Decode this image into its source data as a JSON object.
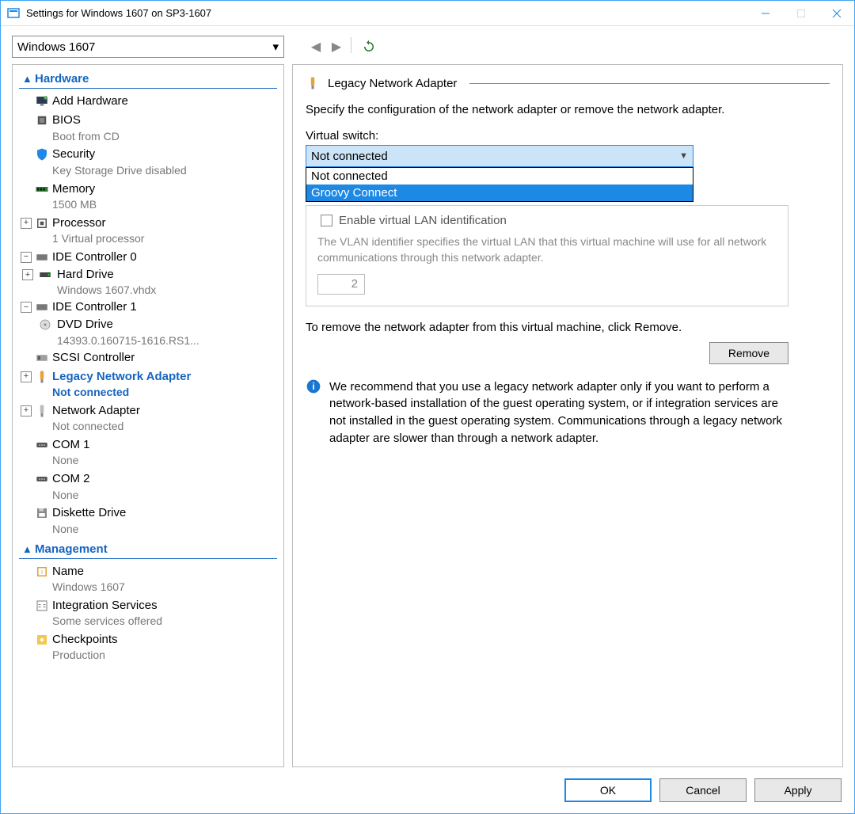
{
  "titlebar": {
    "title": "Settings for Windows 1607 on SP3-1607"
  },
  "vm_selector": {
    "value": "Windows 1607"
  },
  "sidebar": {
    "sections": {
      "hardware": "Hardware",
      "management": "Management"
    },
    "items": [
      {
        "label": "Add Hardware",
        "sub": ""
      },
      {
        "label": "BIOS",
        "sub": "Boot from CD"
      },
      {
        "label": "Security",
        "sub": "Key Storage Drive disabled"
      },
      {
        "label": "Memory",
        "sub": "1500 MB"
      },
      {
        "label": "Processor",
        "sub": "1 Virtual processor"
      },
      {
        "label": "IDE Controller 0",
        "sub": ""
      },
      {
        "label": "Hard Drive",
        "sub": "Windows 1607.vhdx"
      },
      {
        "label": "IDE Controller 1",
        "sub": ""
      },
      {
        "label": "DVD Drive",
        "sub": "14393.0.160715-1616.RS1..."
      },
      {
        "label": "SCSI Controller",
        "sub": ""
      },
      {
        "label": "Legacy Network Adapter",
        "sub": "Not connected"
      },
      {
        "label": "Network Adapter",
        "sub": "Not connected"
      },
      {
        "label": "COM 1",
        "sub": "None"
      },
      {
        "label": "COM 2",
        "sub": "None"
      },
      {
        "label": "Diskette Drive",
        "sub": "None"
      },
      {
        "label": "Name",
        "sub": "Windows 1607"
      },
      {
        "label": "Integration Services",
        "sub": "Some services offered"
      },
      {
        "label": "Checkpoints",
        "sub": "Production"
      }
    ]
  },
  "detail": {
    "title": "Legacy Network Adapter",
    "intro": "Specify the configuration of the network adapter or remove the network adapter.",
    "switch_label": "Virtual switch:",
    "switch_value": "Not connected",
    "switch_options": [
      "Not connected",
      "Groovy Connect"
    ],
    "vlan": {
      "checkbox": "Enable virtual LAN identification",
      "desc": "The VLAN identifier specifies the virtual LAN that this virtual machine will use for all network communications through this network adapter.",
      "value": "2"
    },
    "remove_text": "To remove the network adapter from this virtual machine, click Remove.",
    "remove_btn": "Remove",
    "info": "We recommend that you use a legacy network adapter only if you want to perform a network-based installation of the guest operating system, or if integration services are not installed in the guest operating system. Communications through a legacy network adapter are slower than through a network adapter."
  },
  "footer": {
    "ok": "OK",
    "cancel": "Cancel",
    "apply": "Apply"
  }
}
